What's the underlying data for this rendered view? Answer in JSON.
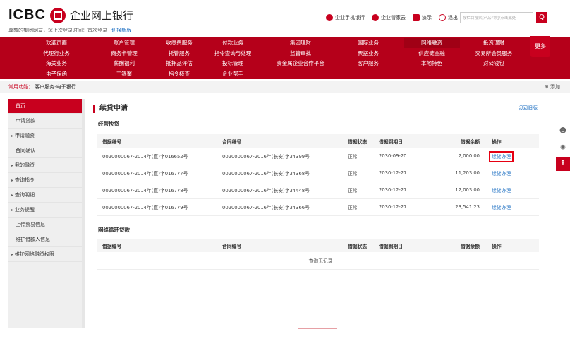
{
  "header": {
    "logo_text": "ICBC",
    "logo_cn": "企业网上银行",
    "welcome": "尊敬的集团网友，您上次登录时间：首次登录",
    "switch_label": "切换新版",
    "tools": [
      {
        "label": "企业手机银行",
        "icon": "mobile-bank-icon",
        "color": "#c8001e"
      },
      {
        "label": "企业管家云",
        "icon": "cloud-icon",
        "color": "#c8001e"
      },
      {
        "label": "演示",
        "icon": "demo-icon",
        "color": "#c8001e"
      },
      {
        "label": "退出",
        "icon": "power-icon",
        "color": "#c8001e"
      }
    ],
    "search_placeholder": "按栏目搜索/产品介绍/点击此处",
    "search_button": "Q"
  },
  "nav": {
    "items": [
      [
        "欢迎页面",
        "账户管理",
        "收缴费服务",
        "付款业务",
        "集团理财",
        "国际业务",
        "网络融资",
        "投资理财"
      ],
      [
        "代理行业务",
        "商务卡管理",
        "托管服务",
        "指令查询与处理",
        "监管审批",
        "票据业务",
        "供应链金融",
        "交易所会员服务"
      ],
      [
        "海关业务",
        "薪酬福利",
        "抵押品评估",
        "投标管理",
        "贵金属企业合作平台",
        "客户服务",
        "本地特色",
        "对公钱包"
      ],
      [
        "电子保函",
        "工银聚",
        "指令核查",
        "企业帮手",
        "",
        "",
        "",
        ""
      ]
    ],
    "active": "网络融资",
    "more": "更多"
  },
  "quick": {
    "label": "常用功能：",
    "item": "客户服务-电子银行...",
    "add": "⊕ 添加"
  },
  "sidebar": {
    "items": [
      {
        "label": "首页",
        "active": true,
        "arrow": false
      },
      {
        "label": "申请贷款",
        "active": false,
        "arrow": false
      },
      {
        "label": "申请融资",
        "active": false,
        "arrow": true
      },
      {
        "label": "合同确认",
        "active": false,
        "arrow": false
      },
      {
        "label": "我的融资",
        "active": false,
        "arrow": true
      },
      {
        "label": "查询指令",
        "active": false,
        "arrow": true
      },
      {
        "label": "查询明细",
        "active": false,
        "arrow": true
      },
      {
        "label": "业务提醒",
        "active": false,
        "arrow": true
      },
      {
        "label": "上传贸易信息",
        "active": false,
        "arrow": false
      },
      {
        "label": "维护借款人信息",
        "active": false,
        "arrow": false
      },
      {
        "label": "维护网络融资权限",
        "active": false,
        "arrow": true
      }
    ]
  },
  "main": {
    "title": "续贷申请",
    "old_version": "切回旧版",
    "section1": "经营快贷",
    "section2": "网络循环贷款",
    "columns": [
      "借据编号",
      "合同编号",
      "借据状态",
      "借据到期日",
      "借据余额",
      "操作"
    ],
    "rows": [
      [
        "0020000067-2014年(直)字016652号",
        "0020000067-2016年(长安)字34399号",
        "正常",
        "2030-09-20",
        "2,000.00",
        "续贷办理"
      ],
      [
        "0020000067-2014年(直)字016777号",
        "0020000067-2016年(长安)字34368号",
        "正常",
        "2030-12-27",
        "11,203.00",
        "续贷办理"
      ],
      [
        "0020000067-2014年(直)字016778号",
        "0020000067-2016年(长安)字34448号",
        "正常",
        "2030-12-27",
        "12,003.00",
        "续贷办理"
      ],
      [
        "0020000067-2014年(直)字016779号",
        "0020000067-2016年(长安)字34366号",
        "正常",
        "2030-12-27",
        "23,541.23",
        "续贷办理"
      ]
    ],
    "empty_text": "查询无记录"
  },
  "colors": {
    "brand": "#c8001e",
    "link": "#1b6ec2",
    "highlight": "#e60012"
  }
}
